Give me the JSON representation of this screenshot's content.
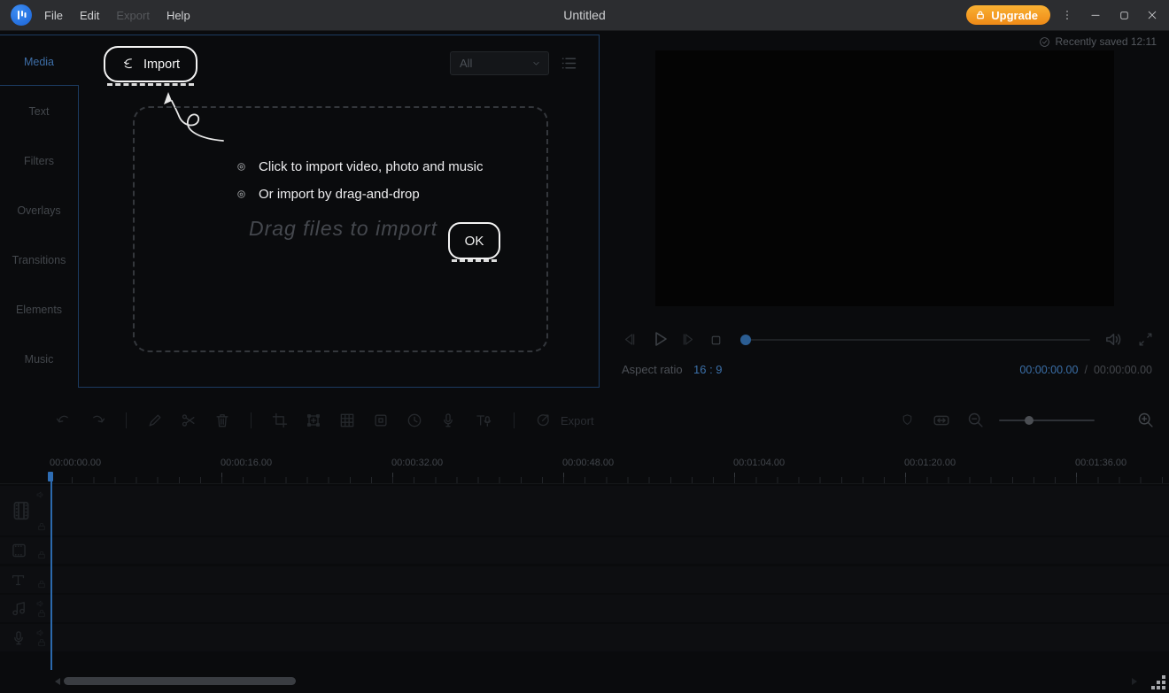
{
  "titlebar": {
    "title": "Untitled",
    "menus": [
      {
        "label": "File",
        "enabled": true
      },
      {
        "label": "Edit",
        "enabled": true
      },
      {
        "label": "Export",
        "enabled": false
      },
      {
        "label": "Help",
        "enabled": true
      }
    ],
    "upgrade_label": "Upgrade"
  },
  "sidebar": {
    "tabs": [
      {
        "label": "Media",
        "active": true
      },
      {
        "label": "Text",
        "active": false
      },
      {
        "label": "Filters",
        "active": false
      },
      {
        "label": "Overlays",
        "active": false
      },
      {
        "label": "Transitions",
        "active": false
      },
      {
        "label": "Elements",
        "active": false
      },
      {
        "label": "Music",
        "active": false
      }
    ]
  },
  "media_panel": {
    "import_button_label": "Import",
    "filter_dropdown_value": "All",
    "instruction_1": "Click to import video, photo and music",
    "instruction_2": "Or import by drag-and-drop",
    "dropzone_hint": "Drag files to import",
    "ok_button_label": "OK"
  },
  "preview": {
    "saved_status": "Recently saved 12:11",
    "aspect_ratio_label": "Aspect ratio",
    "aspect_ratio_value": "16 : 9",
    "current_time": "00:00:00.00",
    "time_separator": "/",
    "total_duration": "00:00:00.00"
  },
  "toolbar": {
    "export_label": "Export",
    "icons": [
      "undo",
      "redo",
      "edit",
      "split",
      "delete",
      "crop",
      "transform",
      "mosaic",
      "freeze-frame",
      "duration",
      "record-voiceover",
      "text-to-speech",
      "export"
    ],
    "right_icons": [
      "shield",
      "fit-timeline",
      "zoom-out",
      "zoom-slider",
      "zoom-in"
    ]
  },
  "timeline": {
    "ruler_labels": [
      "00:00:00.00",
      "00:00:16.00",
      "00:00:32.00",
      "00:00:48.00",
      "00:01:04.00",
      "00:01:20.00",
      "00:01:36.00"
    ],
    "tracks": [
      {
        "name": "video"
      },
      {
        "name": "picture-in-picture"
      },
      {
        "name": "text"
      },
      {
        "name": "music"
      },
      {
        "name": "voiceover"
      }
    ]
  },
  "colors": {
    "accent_blue": "#3b6fa8",
    "upgrade_orange": "#f59a1d",
    "panel_border_blue": "#1c3b61",
    "playhead_blue": "#2d6cb0"
  }
}
